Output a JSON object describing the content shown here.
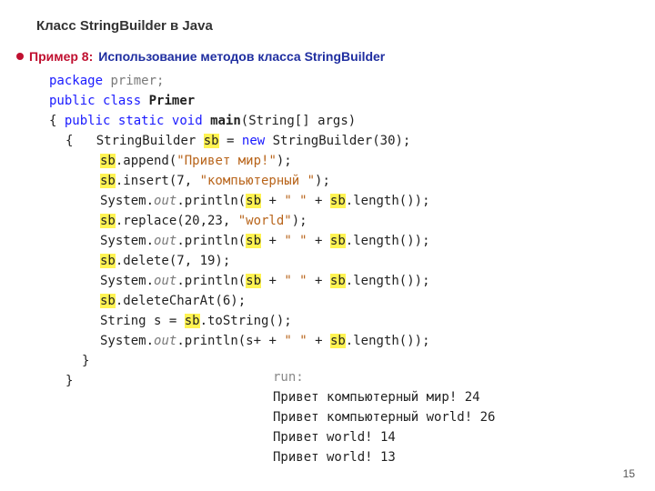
{
  "title": "Класс StringBuilder в Java",
  "example_label": "Пример 8:",
  "subtitle_text": "Использование методов класса StringBuilder",
  "code": {
    "pkg_kw": "package",
    "pkg_name": "primer;",
    "public": "public",
    "class_kw": "class",
    "class_name": "Primer",
    "lb": "{",
    "rb": "}",
    "static": "static",
    "void": "void",
    "main": "main",
    "main_args": "(String[] args)",
    "sb_decl_type": "StringBuilder ",
    "sb": "sb",
    "eq_new": " = ",
    "new": "new",
    "sb_ctor": " StringBuilder(30);",
    "append": ".append(",
    "str_hello": "\"Привет мир!\"",
    "close_paren": ");",
    "insert": ".insert(7, ",
    "str_comp": "\"компьютерный \"",
    "sysout": "System.",
    "out": "out",
    "println": ".println(",
    "plus_space": " + ",
    "str_space": "\" \"",
    "len_call": ".length());",
    "replace": ".replace(20,23, ",
    "str_world": "\"world\"",
    "delete": ".delete(7, 19);",
    "deleteCharAt": ".deleteCharAt(6);",
    "string_decl": "String s = ",
    "tostring": ".toString();",
    "s_var": "s"
  },
  "output": {
    "run": "run:",
    "l1": "Привет компьютерный мир! 24",
    "l2": "Привет компьютерный world! 26",
    "l3": "Привет  world! 14",
    "l4": "Привет world! 13"
  },
  "page_number": "15"
}
